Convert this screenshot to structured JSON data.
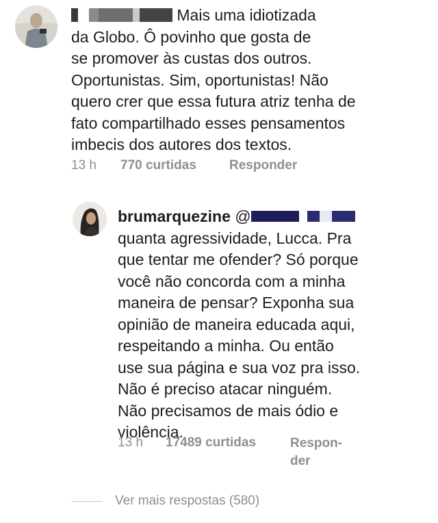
{
  "comment1": {
    "text_lines": [
      "Mais uma idiotizada",
      "da Globo. Ô povinho que gosta de",
      "se promover às custas dos outros.",
      "Oportunistas. Sim, oportunistas! Não",
      "quero crer que essa futura atriz tenha de",
      "fato compartilhado esses pensamentos",
      "imbecis dos autores dos textos."
    ],
    "time": "13 h",
    "likes": "770 curtidas",
    "reply_label": "Responder"
  },
  "reply1": {
    "username": "brumarquezine",
    "mention_prefix": "@",
    "text_lines": [
      "quanta agressividade, Lucca. Pra",
      "que tentar me ofender? Só porque",
      "você não concorda com a minha",
      "maneira de pensar? Exponha sua",
      "opinião de maneira educada aqui,",
      "respeitando a minha. Ou então",
      "use sua página e sua voz pra isso.",
      "Não é preciso atacar ninguém.",
      "Não precisamos de mais ódio e",
      "violência."
    ],
    "time": "13 h",
    "likes": "17489 curtidas",
    "reply_label_line1": "Respon-",
    "reply_label_line2": "der"
  },
  "view_more": "Ver mais respostas (580)"
}
